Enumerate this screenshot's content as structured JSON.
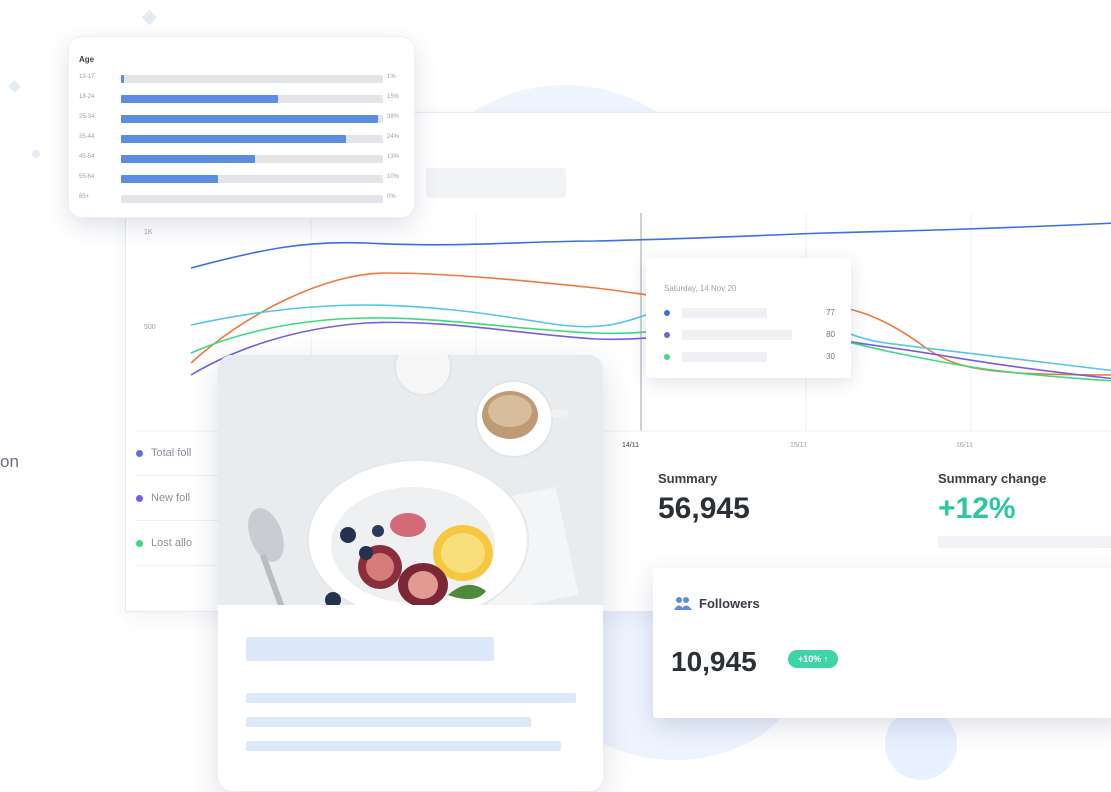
{
  "side_text": "on",
  "age_card": {
    "title": "Age",
    "rows": [
      {
        "label": "13-17",
        "fraction": 0.01,
        "value": "1%"
      },
      {
        "label": "18-24",
        "fraction": 0.6,
        "value": "15%"
      },
      {
        "label": "25-34",
        "fraction": 0.98,
        "value": "38%"
      },
      {
        "label": "35-44",
        "fraction": 0.86,
        "value": "24%"
      },
      {
        "label": "45-54",
        "fraction": 0.51,
        "value": "13%"
      },
      {
        "label": "55-64",
        "fraction": 0.37,
        "value": "10%"
      },
      {
        "label": "65+",
        "fraction": 0.0,
        "value": "0%"
      }
    ],
    "accent": "#5b8de0"
  },
  "chart": {
    "y_ticks": [
      "1K",
      "500"
    ],
    "x_ticks": [
      "14/11",
      "15/11",
      "16/11"
    ],
    "series": [
      {
        "color": "#3d6fe0"
      },
      {
        "color": "#f0783c"
      },
      {
        "color": "#55c6e6"
      },
      {
        "color": "#7a5ce0"
      },
      {
        "color": "#3ddc7a"
      }
    ],
    "legend": [
      {
        "label": "Total foll",
        "color": "#5b6fe0"
      },
      {
        "label": "New foll",
        "color": "#7a5ce0"
      },
      {
        "label": "Lost allo",
        "color": "#3ddc7a"
      }
    ],
    "tooltip": {
      "title": "Saturday, 14 Nov 20",
      "rows": [
        {
          "color": "#3d6fe0",
          "value": "77"
        },
        {
          "color": "#7a5ce0",
          "value": "80"
        },
        {
          "color": "#3ddc7a",
          "value": "30"
        }
      ]
    }
  },
  "summary": {
    "label": "Summary",
    "value": "56,945"
  },
  "summary_change": {
    "label": "Summary change",
    "value": "+12%",
    "color": "#2dc6a3"
  },
  "followers": {
    "label": "Followers",
    "value": "10,945",
    "badge": "+10% ↑",
    "badge_color": "#3fd3a8"
  }
}
